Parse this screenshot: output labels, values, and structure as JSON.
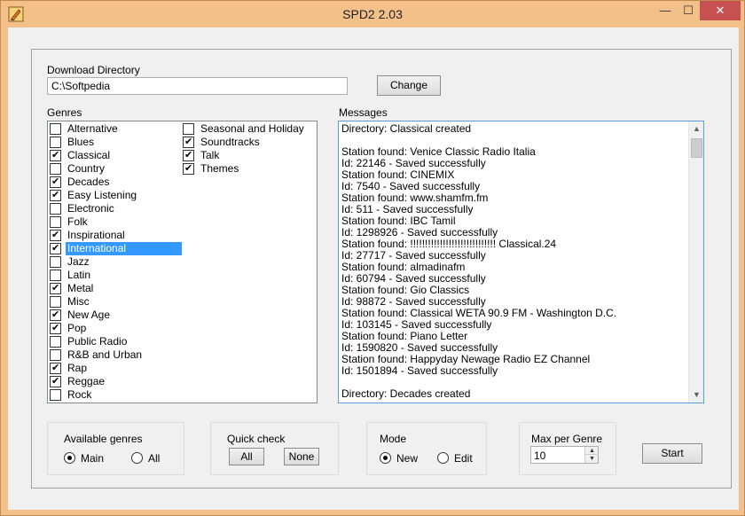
{
  "window": {
    "title": "SPD2 2.03",
    "minimize_glyph": "—",
    "maximize_glyph": "☐",
    "close_glyph": "✕"
  },
  "download": {
    "label": "Download Directory",
    "path": "C:\\Softpedia",
    "change_label": "Change"
  },
  "genres": {
    "label": "Genres",
    "column1": [
      {
        "label": "Alternative",
        "checked": false
      },
      {
        "label": "Blues",
        "checked": false
      },
      {
        "label": "Classical",
        "checked": true
      },
      {
        "label": "Country",
        "checked": false
      },
      {
        "label": "Decades",
        "checked": true
      },
      {
        "label": "Easy Listening",
        "checked": true
      },
      {
        "label": "Electronic",
        "checked": false
      },
      {
        "label": "Folk",
        "checked": false
      },
      {
        "label": "Inspirational",
        "checked": true
      },
      {
        "label": "International",
        "checked": true,
        "selected": true
      },
      {
        "label": "Jazz",
        "checked": false
      },
      {
        "label": "Latin",
        "checked": false
      },
      {
        "label": "Metal",
        "checked": true
      },
      {
        "label": "Misc",
        "checked": false
      },
      {
        "label": "New Age",
        "checked": true
      },
      {
        "label": "Pop",
        "checked": true
      },
      {
        "label": "Public Radio",
        "checked": false
      },
      {
        "label": "R&B and Urban",
        "checked": false
      },
      {
        "label": "Rap",
        "checked": true
      },
      {
        "label": "Reggae",
        "checked": true
      },
      {
        "label": "Rock",
        "checked": false
      }
    ],
    "column2": [
      {
        "label": "Seasonal and Holiday",
        "checked": false
      },
      {
        "label": "Soundtracks",
        "checked": true
      },
      {
        "label": "Talk",
        "checked": true
      },
      {
        "label": "Themes",
        "checked": true
      }
    ]
  },
  "messages": {
    "label": "Messages",
    "lines": [
      "Directory: Classical created",
      "",
      "Station found: Venice Classic Radio Italia",
      "Id: 22146 - Saved successfully",
      "Station found: CINEMIX",
      "Id: 7540 - Saved successfully",
      "Station found: www.shamfm.fm",
      "Id: 511 - Saved successfully",
      "Station found: IBC Tamil",
      "Id: 1298926 - Saved successfully",
      "Station found: !!!!!!!!!!!!!!!!!!!!!!!!!!!!! Classical.24",
      "Id: 27717 - Saved successfully",
      "Station found: almadinafm",
      "Id: 60794 - Saved successfully",
      "Station found:  Gio Classics",
      "Id: 98872 - Saved successfully",
      "Station found: Classical WETA 90.9 FM - Washington D.C.",
      "Id: 103145 - Saved successfully",
      "Station found: Piano Letter",
      "Id: 1590820 - Saved successfully",
      "Station found: Happyday Newage Radio EZ Channel",
      "Id: 1501894 - Saved successfully",
      "",
      "Directory: Decades created"
    ]
  },
  "available_genres": {
    "label": "Available genres",
    "main_label": "Main",
    "all_label": "All",
    "selected": "Main"
  },
  "quick_check": {
    "label": "Quick check",
    "all_label": "All",
    "none_label": "None"
  },
  "mode": {
    "label": "Mode",
    "new_label": "New",
    "edit_label": "Edit",
    "selected": "New"
  },
  "max_per_genre": {
    "label": "Max per Genre",
    "value": "10"
  },
  "start_label": "Start"
}
